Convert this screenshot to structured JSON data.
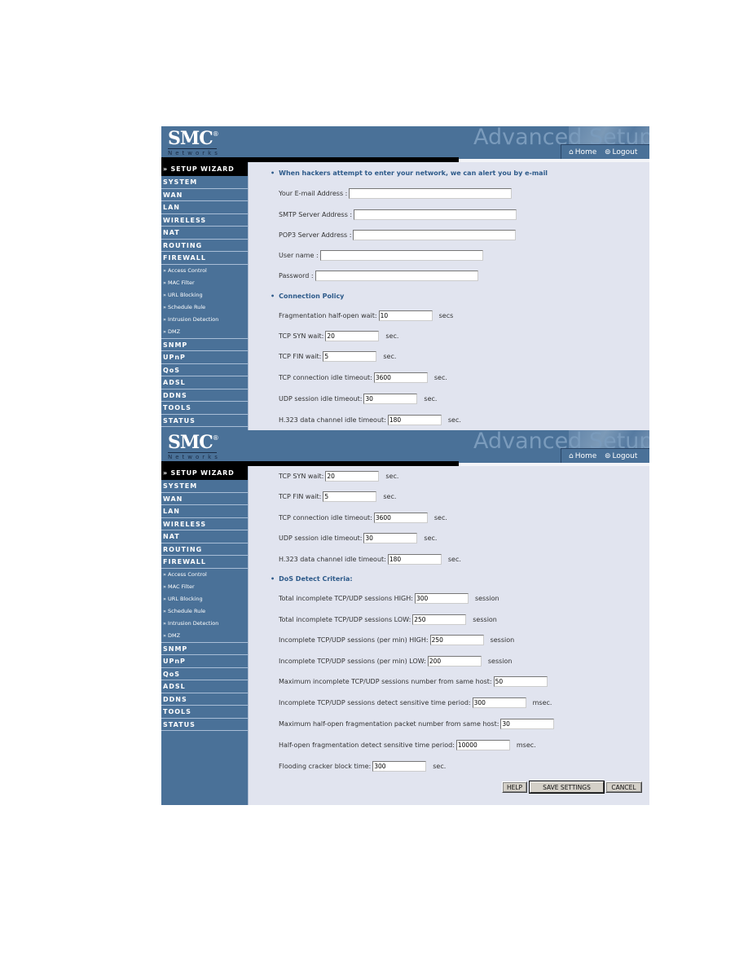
{
  "header": {
    "logo_text": "SMC",
    "logo_reg": "®",
    "logo_sub": "Networks",
    "title": "Advanced Setup",
    "home_label": "Home",
    "logout_label": "Logout",
    "home_icon": "home-icon",
    "logout_icon": "logout-icon"
  },
  "sidebar": {
    "wizard": "» SETUP WIZARD",
    "items_top": [
      "SYSTEM",
      "WAN",
      "LAN",
      "WIRELESS",
      "NAT",
      "ROUTING",
      "FIREWALL"
    ],
    "firewall_sub": [
      "» Access Control",
      "» MAC Filter",
      "» URL Blocking",
      "» Schedule Rule",
      "» Intrusion Detection",
      "» DMZ"
    ],
    "items_bottom": [
      "SNMP",
      "UPnP",
      "QoS",
      "ADSL",
      "DDNS",
      "TOOLS",
      "STATUS"
    ]
  },
  "panel1": {
    "email_section": "When hackers attempt to enter your network, we can alert you by e-mail",
    "email_label": "Your E-mail Address :",
    "email_value": "",
    "smtp_label": "SMTP Server Address :",
    "smtp_value": "",
    "pop3_label": "POP3 Server Address :",
    "pop3_value": "",
    "user_label": "User name :",
    "user_value": "",
    "password_label": "Password :",
    "password_value": "",
    "policy_section": "Connection Policy",
    "frag_label": "Fragmentation half-open wait:",
    "frag_value": "10",
    "frag_unit": "secs",
    "syn_label": "TCP SYN wait:",
    "syn_value": "20",
    "syn_unit": "sec.",
    "fin_label": "TCP FIN wait:",
    "fin_value": "5",
    "fin_unit": "sec.",
    "idle_label": "TCP connection idle timeout:",
    "idle_value": "3600",
    "idle_unit": "sec.",
    "udp_label": "UDP session idle timeout:",
    "udp_value": "30",
    "udp_unit": "sec.",
    "h323_label": "H.323 data channel idle timeout:",
    "h323_value": "180",
    "h323_unit": "sec."
  },
  "panel2": {
    "syn_label": "TCP SYN wait:",
    "syn_value": "20",
    "syn_unit": "sec.",
    "fin_label": "TCP FIN wait:",
    "fin_value": "5",
    "fin_unit": "sec.",
    "idle_label": "TCP connection idle timeout:",
    "idle_value": "3600",
    "idle_unit": "sec.",
    "udp_label": "UDP session idle timeout:",
    "udp_value": "30",
    "udp_unit": "sec.",
    "h323_label": "H.323 data channel idle timeout:",
    "h323_value": "180",
    "h323_unit": "sec.",
    "dos_section": "DoS Detect Criteria:",
    "total_high_label": "Total incomplete TCP/UDP sessions HIGH:",
    "total_high_value": "300",
    "total_high_unit": "session",
    "total_low_label": "Total incomplete TCP/UDP sessions LOW:",
    "total_low_value": "250",
    "total_low_unit": "session",
    "min_high_label": "Incomplete TCP/UDP sessions (per min) HIGH:",
    "min_high_value": "250",
    "min_high_unit": "session",
    "min_low_label": "Incomplete TCP/UDP sessions (per min) LOW:",
    "min_low_value": "200",
    "min_low_unit": "session",
    "max_host_label": "Maximum incomplete TCP/UDP sessions number from same host:",
    "max_host_value": "50",
    "detect_period_label": "Incomplete TCP/UDP sessions detect sensitive time period:",
    "detect_period_value": "300",
    "detect_period_unit": "msec.",
    "max_frag_label": "Maximum half-open fragmentation packet number from same host:",
    "max_frag_value": "30",
    "frag_period_label": "Half-open fragmentation detect sensitive time period:",
    "frag_period_value": "10000",
    "frag_period_unit": "msec.",
    "block_label": "Flooding cracker block time:",
    "block_value": "300",
    "block_unit": "sec.",
    "help_button": "HELP",
    "save_button": "SAVE SETTINGS",
    "cancel_button": "CANCEL"
  }
}
